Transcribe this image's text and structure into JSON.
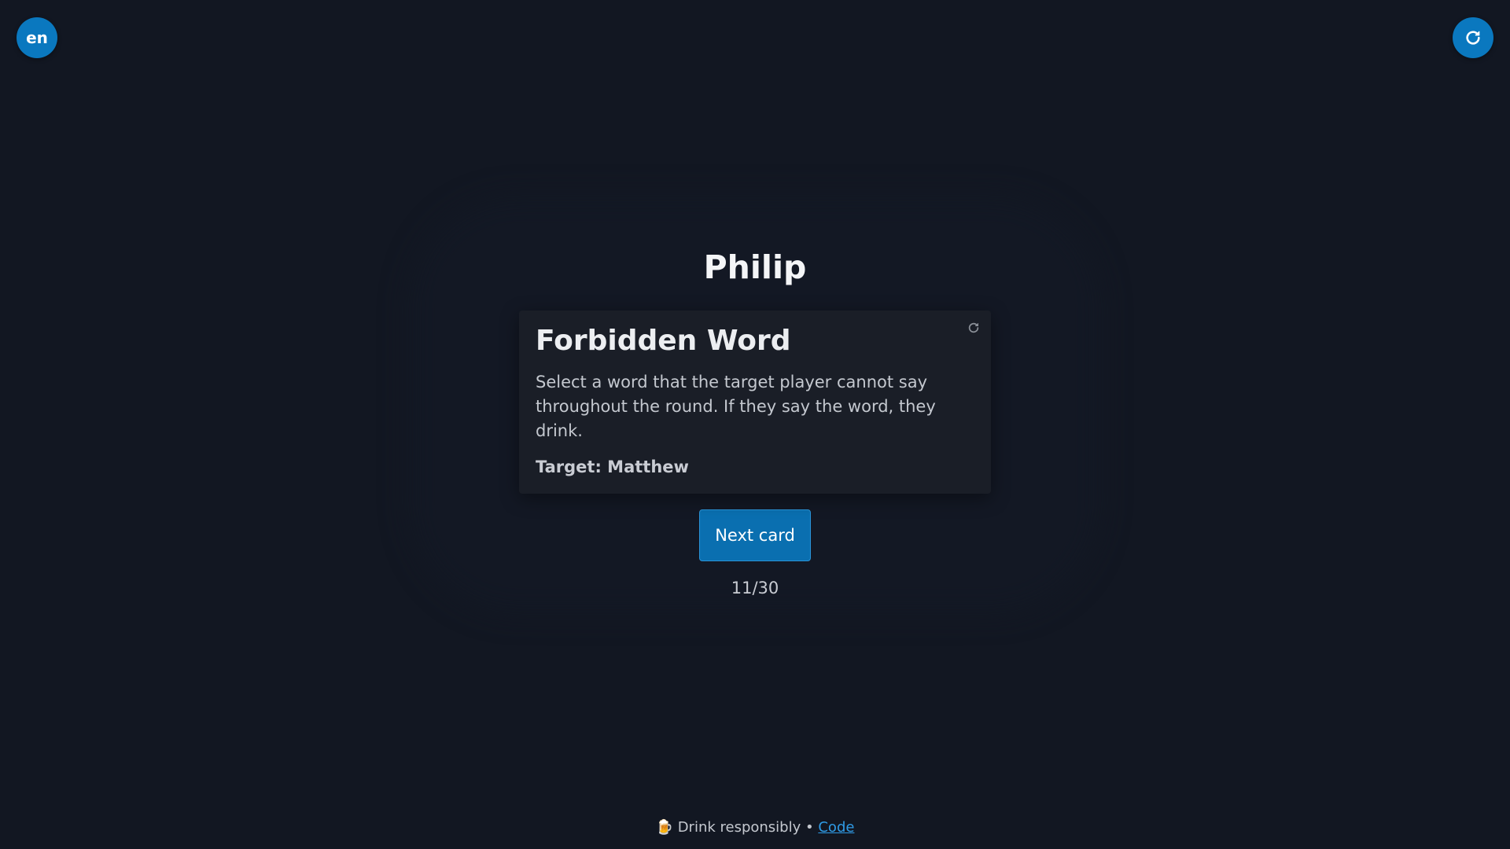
{
  "header": {
    "language_label": "en"
  },
  "main": {
    "player_name": "Philip",
    "card": {
      "title": "Forbidden Word",
      "description": "Select a word that the target player cannot say throughout the round. If they say the word, they drink.",
      "target": "Target: Matthew"
    },
    "next_button_label": "Next card",
    "progress": "11/30"
  },
  "footer": {
    "emoji": "🍺",
    "text": "Drink responsibly",
    "separator": "•",
    "link_label": "Code"
  },
  "colors": {
    "background": "#121722",
    "accent": "#0a78bf",
    "card_background": "#1a1e27",
    "link": "#2f9be6"
  },
  "icons": {
    "restart": "refresh-icon",
    "card_reroll": "refresh-icon"
  }
}
